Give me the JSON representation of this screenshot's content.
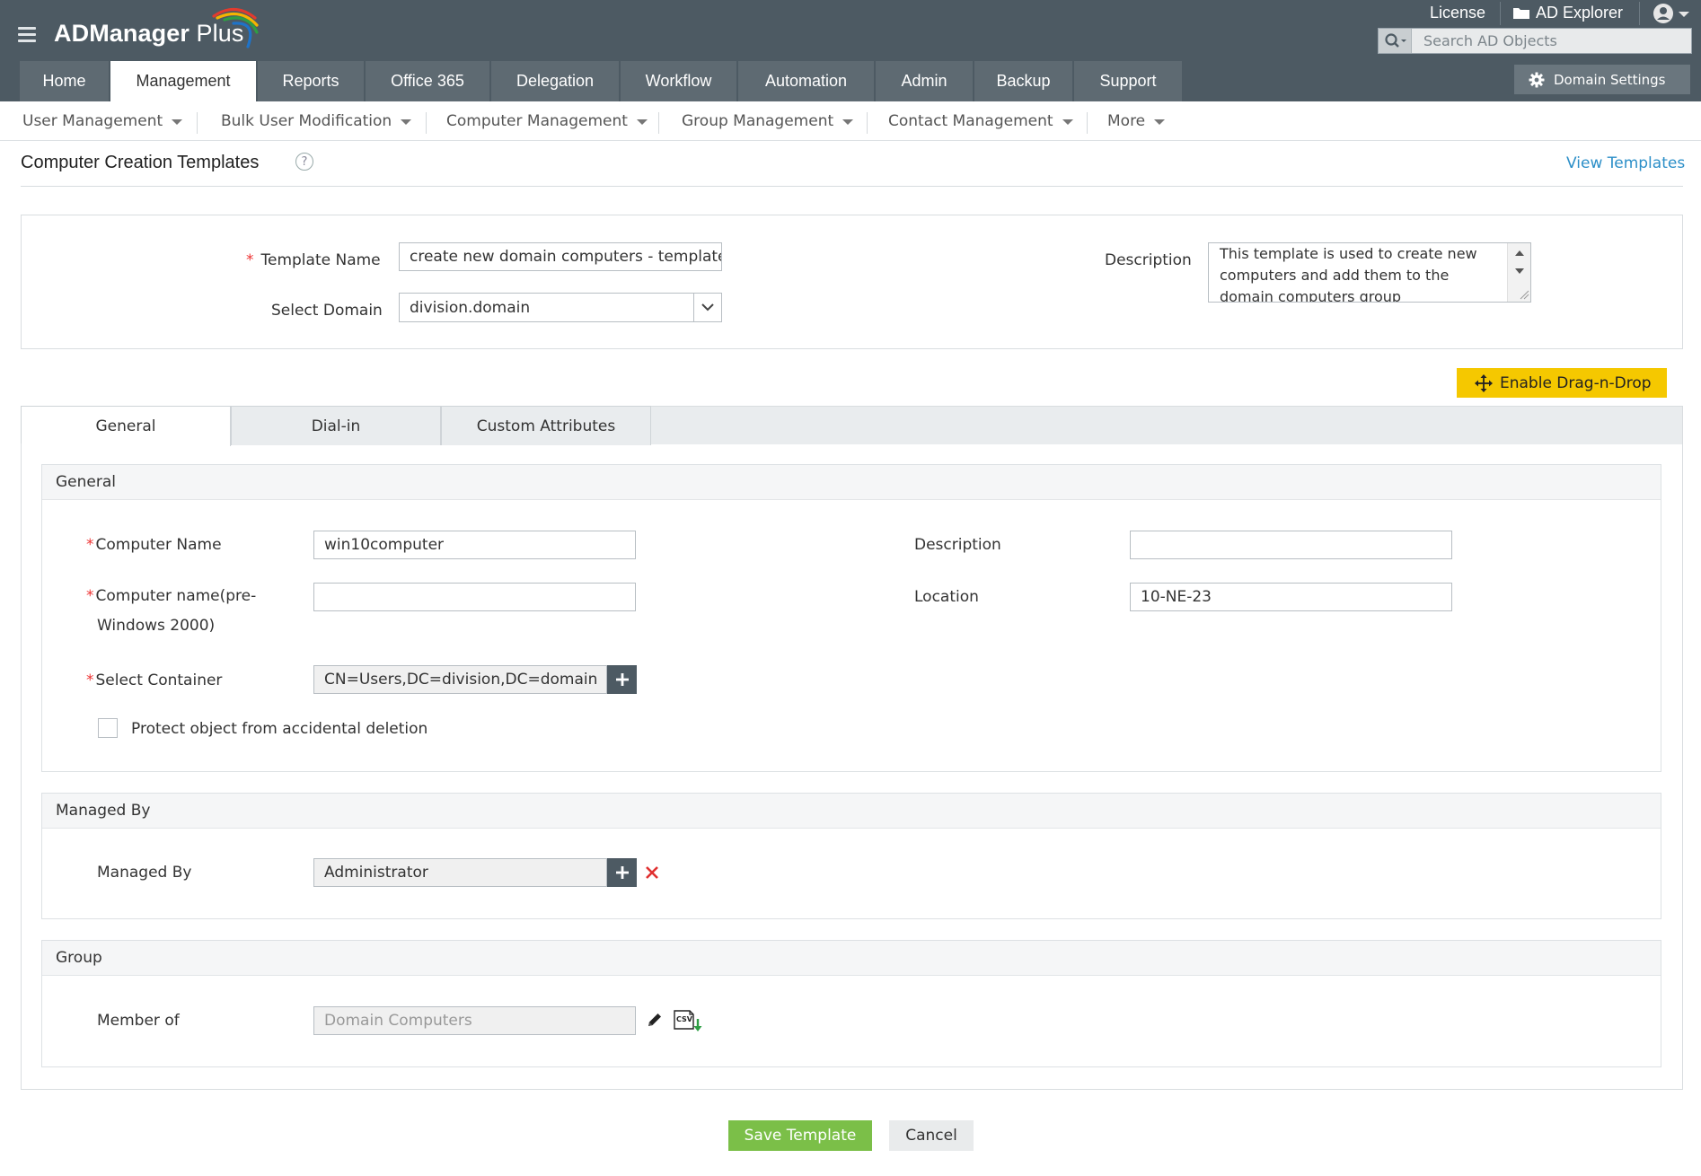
{
  "header": {
    "app_name": "ADManager",
    "app_name_suffix": "Plus",
    "license_label": "License",
    "ad_explorer_label": "AD Explorer",
    "search": {
      "placeholder": "Search AD Objects",
      "value": ""
    },
    "domain_settings_label": "Domain Settings",
    "brand_colors": [
      "#e23b2e",
      "#f5b400",
      "#2e9e44",
      "#1f73c8"
    ]
  },
  "main_nav": {
    "items": [
      "Home",
      "Management",
      "Reports",
      "Office 365",
      "Delegation",
      "Workflow",
      "Automation",
      "Admin",
      "Backup",
      "Support"
    ],
    "active": "Management"
  },
  "sub_nav": {
    "items": [
      "User Management",
      "Bulk User Modification",
      "Computer Management",
      "Group Management",
      "Contact Management",
      "More"
    ]
  },
  "page": {
    "title": "Computer Creation Templates",
    "view_templates_label": "View Templates"
  },
  "template_form": {
    "template_name_label": "Template Name",
    "template_name_value": "create new domain computers - template",
    "select_domain_label": "Select Domain",
    "select_domain_value": "division.domain",
    "description_label": "Description",
    "description_value": "This template is used to create new computers and add them to the domain computers group"
  },
  "enable_dnd_label": "Enable Drag-n-Drop",
  "tabs": {
    "items": [
      "General",
      "Dial-in",
      "Custom Attributes"
    ],
    "active": "General"
  },
  "general_section": {
    "title": "General",
    "computer_name_label": "Computer Name",
    "computer_name_value": "win10computer",
    "computer_name_pre_label_line1": "Computer name(pre-",
    "computer_name_pre_label_line2": "Windows 2000)",
    "computer_name_pre_value": "",
    "select_container_label": "Select Container",
    "select_container_value": "CN=Users,DC=division,DC=domain",
    "protect_label": "Protect object from accidental deletion",
    "protect_checked": false,
    "description_label": "Description",
    "description_value": "",
    "location_label": "Location",
    "location_value": "10-NE-23"
  },
  "managed_by_section": {
    "title": "Managed By",
    "managed_by_label": "Managed By",
    "managed_by_value": "Administrator"
  },
  "group_section": {
    "title": "Group",
    "member_of_label": "Member of",
    "member_of_value": "Domain Computers",
    "csv_icon_text": "CSV"
  },
  "footer": {
    "save_label": "Save Template",
    "cancel_label": "Cancel"
  },
  "colors": {
    "header_bg": "#4d5a63",
    "nav_tab_bg": "#5e6a72",
    "accent_link": "#2c8fc8",
    "dnd_button": "#f5c800",
    "save_button": "#7bbf48",
    "required": "#e33333",
    "remove_icon": "#e03030"
  }
}
